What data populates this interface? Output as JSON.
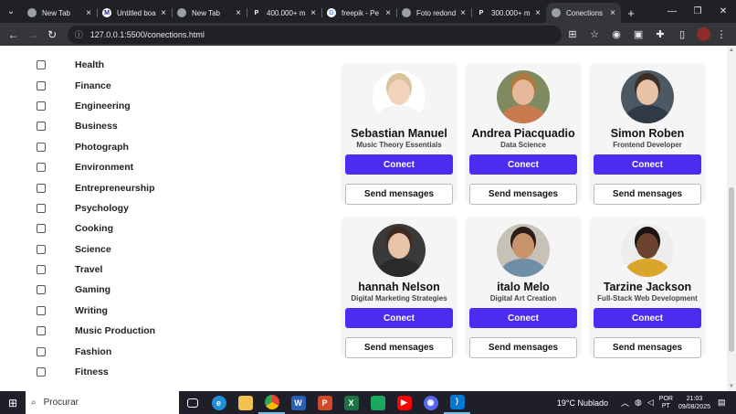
{
  "browser": {
    "tabs": [
      {
        "label": "New Tab",
        "icon": "chrome-icon"
      },
      {
        "label": "Untitled boa",
        "icon": "miro-icon"
      },
      {
        "label": "New Tab",
        "icon": "chrome-icon"
      },
      {
        "label": "400.000+ m",
        "icon": "pexels-icon"
      },
      {
        "label": "freepik - Pe",
        "icon": "google-icon"
      },
      {
        "label": "Foto redond",
        "icon": "globe-icon"
      },
      {
        "label": "300.000+ m",
        "icon": "pexels-icon"
      },
      {
        "label": "Conections",
        "icon": "globe-icon"
      }
    ],
    "new_tab": "+",
    "url": "127.0.0.1:5500/conections.html"
  },
  "categories": [
    "Health",
    "Finance",
    "Engineering",
    "Business",
    "Photograph",
    "Environment",
    "Entrepreneurship",
    "Psychology",
    "Cooking",
    "Science",
    "Travel",
    "Gaming",
    "Writing",
    "Music Production",
    "Fashion",
    "Fitness"
  ],
  "profiles": [
    {
      "name": "Sebastian Manuel",
      "role": "Music Theory Essentials",
      "skin": "#f1d2bb",
      "hair": "#d9c39a",
      "shirt": "#f4f4f4",
      "bg": "#ffffff"
    },
    {
      "name": "Andrea Piacquadio",
      "role": "Data Science",
      "skin": "#e6b99a",
      "hair": "#b0793f",
      "shirt": "#c97b4f",
      "bg": "#7e8a5f"
    },
    {
      "name": "Simon Roben",
      "role": "Frontend Developer",
      "skin": "#e7c2a6",
      "hair": "#3a2f28",
      "shirt": "#2f3a44",
      "bg": "#4c5963"
    },
    {
      "name": "hannah Nelson",
      "role": "Digital Marketing Strategies",
      "skin": "#e9c3a7",
      "hair": "#3d2a20",
      "shirt": "#2a2a2a",
      "bg": "#3a3a3a"
    },
    {
      "name": "italo Melo",
      "role": "Digital Art Creation",
      "skin": "#c8936b",
      "hair": "#2b1d16",
      "shirt": "#6f8fa6",
      "bg": "#c7c2b8"
    },
    {
      "name": "Tarzine Jackson",
      "role": "Full-Stack Web Development",
      "skin": "#6b4330",
      "hair": "#1b1410",
      "shirt": "#d9a62b",
      "bg": "#ededed"
    }
  ],
  "buttons": {
    "conect": "Conect",
    "send": "Send mensages"
  },
  "taskbar": {
    "search": "Procurar",
    "weather": "19°C  Nublado",
    "lang_top": "POR",
    "lang_bottom": "PT",
    "time": "21:03",
    "date": "09/08/2025"
  },
  "colors": {
    "primary": "#4a2df0",
    "card": "#f5f5f5"
  }
}
